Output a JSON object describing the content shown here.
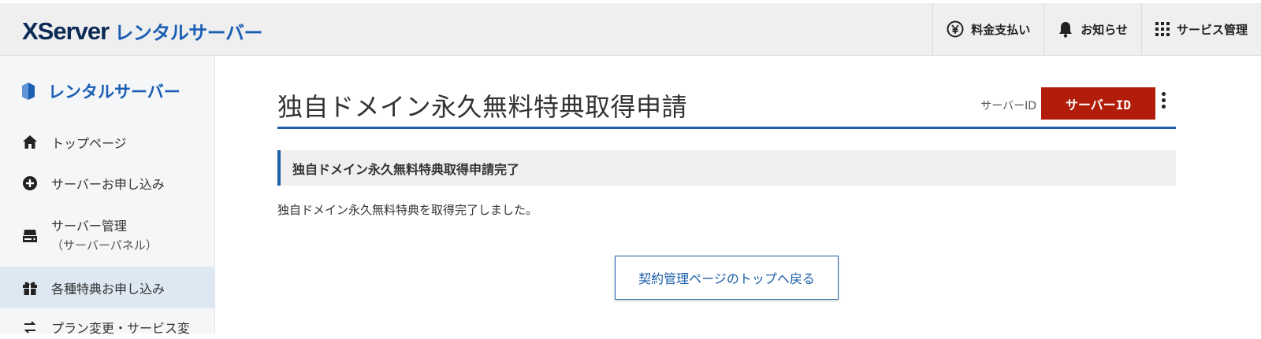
{
  "header": {
    "logo_main": "XServer",
    "logo_sub": "レンタルサーバー",
    "nav": [
      {
        "label": "料金支払い",
        "icon": "yen-icon"
      },
      {
        "label": "お知らせ",
        "icon": "bell-icon"
      },
      {
        "label": "サービス管理",
        "icon": "grid-icon"
      }
    ]
  },
  "sidebar": {
    "title": "レンタルサーバー",
    "items": [
      {
        "label": "トップページ",
        "icon": "home-icon"
      },
      {
        "label": "サーバーお申し込み",
        "icon": "plus-circle-icon"
      },
      {
        "label": "サーバー管理",
        "sub": "（サーバーパネル）",
        "icon": "server-icon"
      },
      {
        "label": "各種特典お申し込み",
        "icon": "gift-icon",
        "active": true
      },
      {
        "label": "プラン変更・サービス変",
        "icon": "swap-icon"
      }
    ]
  },
  "main": {
    "title": "独自ドメイン永久無料特典取得申請",
    "server_id_label": "サーバーID",
    "server_id_button": "サーバーID",
    "section_title": "独自ドメイン永久無料特典取得申請完了",
    "message": "独自ドメイン永久無料特典を取得完了しました。",
    "back_button": "契約管理ページのトップへ戻る"
  },
  "colors": {
    "accent": "#1b5fa8",
    "server_id_bg": "#b21d0b",
    "header_bg": "#efefef",
    "sidebar_active": "#dde8f2"
  }
}
